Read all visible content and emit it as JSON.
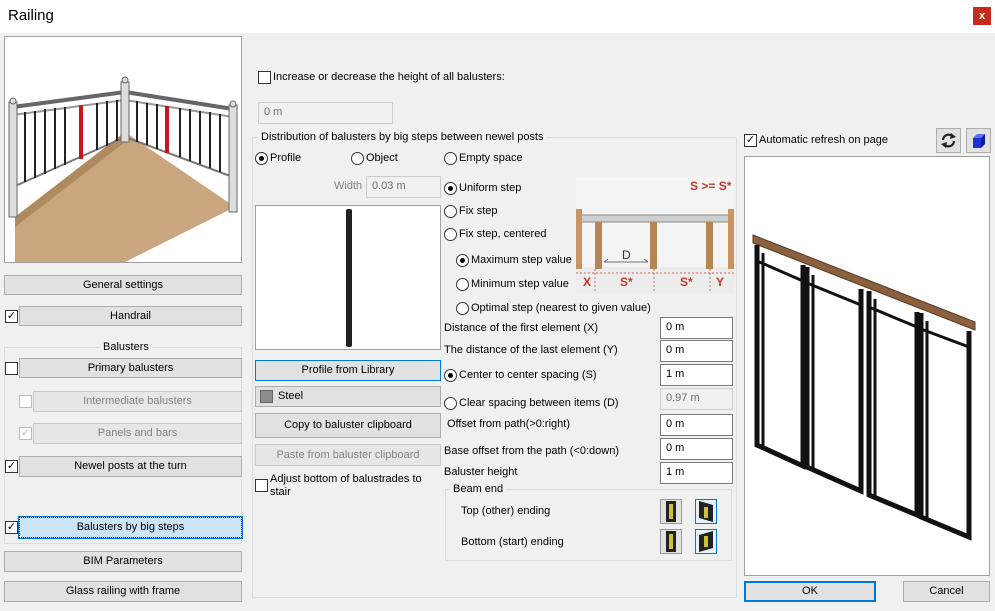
{
  "window": {
    "title": "Railing",
    "close_glyph": "x"
  },
  "left": {
    "general_settings": "General settings",
    "handrail": {
      "label": "Handrail",
      "checked": true
    },
    "balusters_header": "Balusters",
    "primary_balusters": {
      "label": "Primary balusters",
      "checked": false
    },
    "intermediate_balusters": {
      "label": "Intermediate balusters",
      "checked": false
    },
    "panels_and_bars": {
      "label": "Panels and bars",
      "checked": true
    },
    "newel_posts": {
      "label": "Newel posts at the turn",
      "checked": true
    },
    "big_steps": {
      "label": "Balusters by big steps",
      "checked": true
    },
    "bim_parameters": "BIM Parameters",
    "glass_railing": "Glass railing with frame"
  },
  "top": {
    "height_checkbox_label": "Increase or decrease the height of all balusters:",
    "height_value": "0 m"
  },
  "distribution": {
    "group_title": "Distribution of balusters by big steps between newel posts",
    "type_options": [
      "Profile",
      "Object",
      "Empty space"
    ],
    "selected_type": "Profile",
    "width_label": "Width",
    "width_value": "0.03 m",
    "profile_from_library": "Profile from Library",
    "material": "Steel",
    "copy_clipboard": "Copy to baluster clipboard",
    "paste_clipboard": "Paste from baluster clipboard",
    "adjust_bottom": "Adjust bottom of balustrades to stair",
    "step_options": [
      "Uniform step",
      "Fix step",
      "Fix step, centered"
    ],
    "selected_step": "Uniform step",
    "sub_step_options": [
      "Maximum step value",
      "Minimum step value",
      "Optimal step (nearest to given value)"
    ],
    "selected_sub_step": "Maximum step value",
    "diagram_labels": {
      "formula": "S >= S*",
      "d": "D",
      "x": "X",
      "s1": "S*",
      "s2": "S*",
      "y": "Y"
    },
    "fields": {
      "first_element_label": "Distance of the first element (X)",
      "first_element_value": "0 m",
      "last_element_label": "The distance of the last element (Y)",
      "last_element_value": "0 m",
      "center_spacing_label": "Center to center spacing (S)",
      "center_spacing_value": "1 m",
      "clear_spacing_label": "Clear spacing between items (D)",
      "clear_spacing_value": "0.97 m",
      "offset_path_label": "Offset from path(>0:right)",
      "offset_path_value": "0 m",
      "base_offset_label": "Base offset from the path (<0:down)",
      "base_offset_value": "0 m",
      "baluster_height_label": "Baluster height",
      "baluster_height_value": "1 m"
    },
    "spacing_mode": "center",
    "beam_end": {
      "title": "Beam end",
      "top_label": "Top (other) ending",
      "bottom_label": "Bottom (start) ending"
    }
  },
  "preview": {
    "auto_refresh_label": "Automatic refresh on page",
    "auto_refresh_checked": true
  },
  "footer": {
    "ok": "OK",
    "cancel": "Cancel"
  }
}
